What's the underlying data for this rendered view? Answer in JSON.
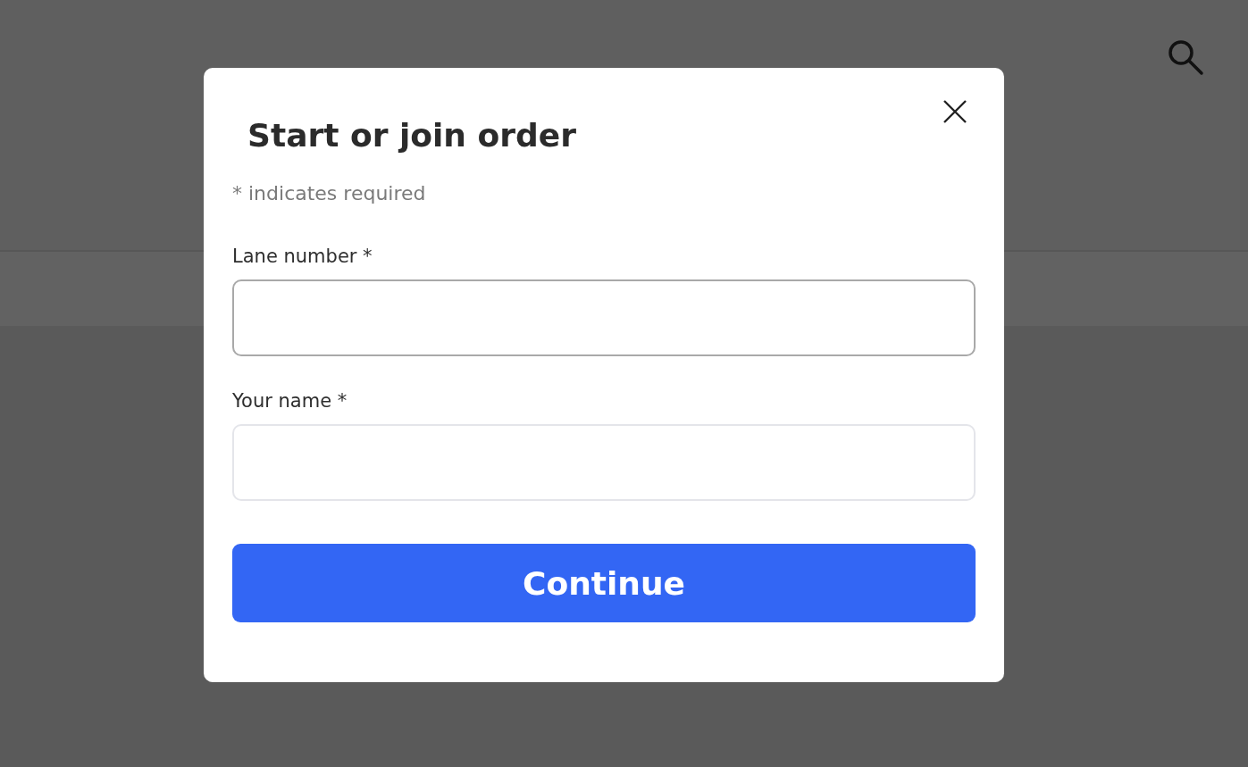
{
  "dialog": {
    "title": "Start or join order",
    "note": "* indicates required",
    "fields": [
      {
        "label": "Lane number *",
        "focused": true
      },
      {
        "label": "Your name *",
        "focused": false
      }
    ],
    "button": "Continue"
  }
}
